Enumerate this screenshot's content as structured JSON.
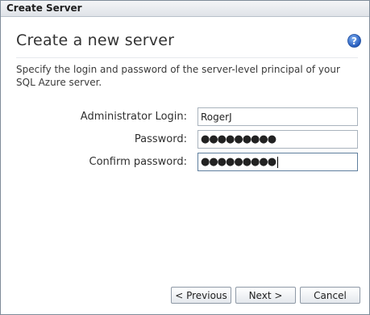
{
  "window": {
    "title": "Create Server"
  },
  "page": {
    "heading": "Create a new server",
    "description": "Specify the login and password of the server-level principal of your SQL Azure server.",
    "help_icon": "help-question-icon"
  },
  "form": {
    "admin_login_label": "Administrator Login:",
    "admin_login_value": "RogerJ",
    "password_label": "Password:",
    "password_value": "●●●●●●●●●",
    "confirm_password_label": "Confirm password:",
    "confirm_password_value": "●●●●●●●●●"
  },
  "buttons": {
    "previous": "< Previous",
    "next": "Next >",
    "cancel": "Cancel"
  },
  "colors": {
    "help_icon": "#2a64c5",
    "border": "#7f8c99"
  }
}
